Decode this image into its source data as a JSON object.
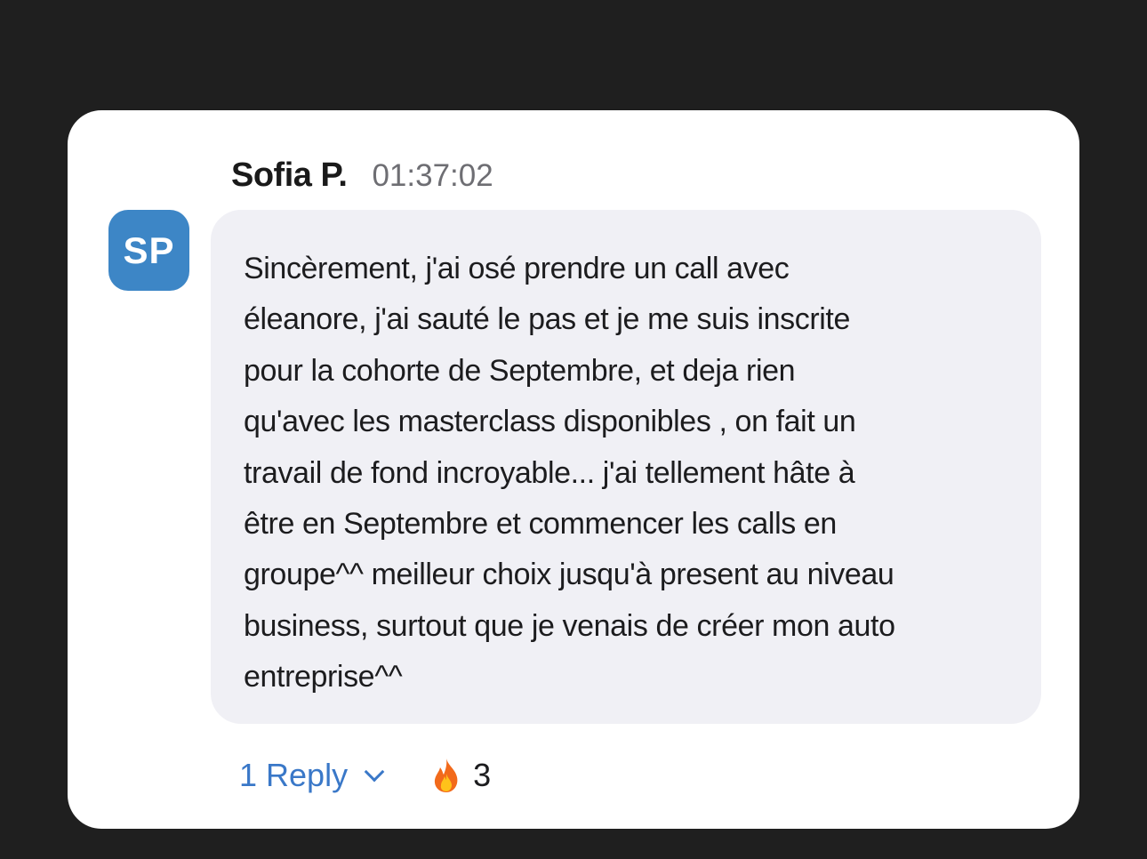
{
  "message": {
    "avatar_initials": "SP",
    "avatar_color": "#3d86c6",
    "author": "Sofia P.",
    "time": "01:37:02",
    "text": "Sincèrement, j'ai osé prendre un call avec\néleanore,  j'ai sauté le pas et je me suis inscrite\npour la cohorte de Septembre, et deja rien\nqu'avec les masterclass disponibles , on fait un\ntravail de fond incroyable... j'ai tellement hâte à\nêtre en Septembre et commencer les calls en\ngroupe^^ meilleur choix jusqu'à present au niveau\nbusiness, surtout que je venais de créer mon auto\nentreprise^^"
  },
  "footer": {
    "reply_label": "1 Reply",
    "reply_icon": "chevron-down-icon",
    "reaction_icon": "fire-emoji-icon",
    "reaction_count": "3",
    "link_color": "#3a78c8"
  }
}
